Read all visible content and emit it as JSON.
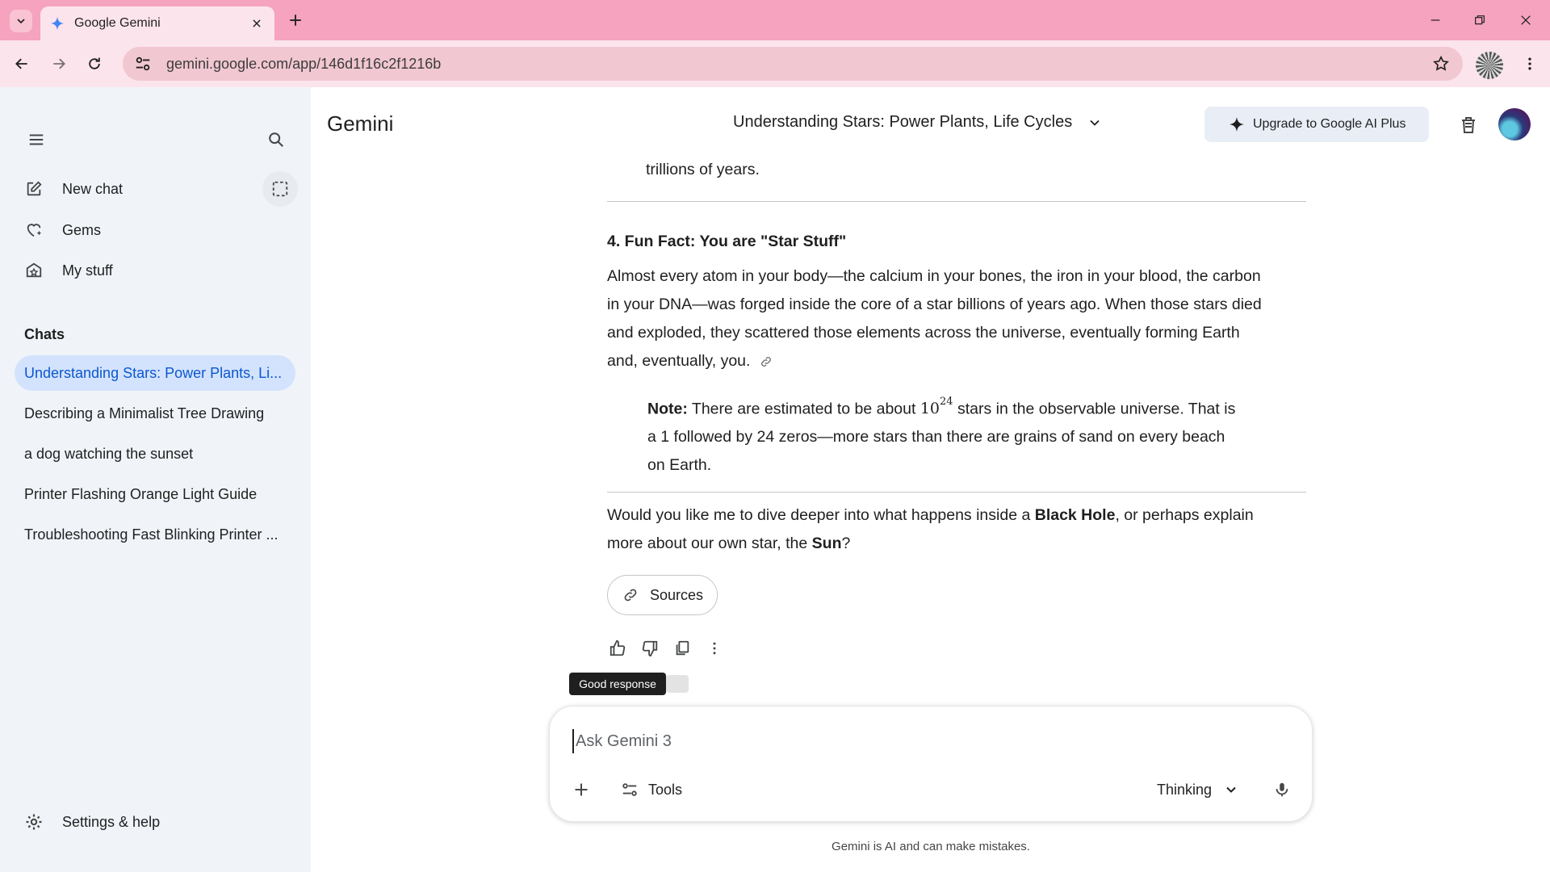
{
  "browser": {
    "tab_title": "Google Gemini",
    "url": "gemini.google.com/app/146d1f16c2f1216b"
  },
  "sidebar": {
    "items": [
      {
        "label": "New chat"
      },
      {
        "label": "Gems"
      },
      {
        "label": "My stuff"
      }
    ],
    "chats_heading": "Chats",
    "chats": [
      "Understanding Stars: Power Plants, Li...",
      "Describing a Minimalist Tree Drawing",
      "a dog watching the sunset",
      "Printer Flashing Orange Light Guide",
      "Troubleshooting Fast Blinking Printer ..."
    ],
    "settings_label": "Settings & help"
  },
  "header": {
    "brand": "Gemini",
    "conversation_title": "Understanding Stars: Power Plants, Life Cycles",
    "upgrade_label": "Upgrade to Google AI Plus"
  },
  "response": {
    "prev_tail": "trillions of years.",
    "fun_fact_heading": "4. Fun Fact: You are \"Star Stuff\"",
    "fun_fact_lines": [
      "Almost every atom in your body—the calcium in your bones, the iron in your blood, the carbon",
      "in your DNA—was forged inside the core of a star billions of years ago. When those stars died",
      "and exploded, they scattered those elements across the universe, eventually forming Earth",
      "and, eventually, you."
    ],
    "note_label": "Note:",
    "note_pre": "There are estimated to be about",
    "note_base": "10",
    "note_exp": "24",
    "note_post": "stars in the observable universe. That is",
    "note_line2": "a 1 followed by 24 zeros—more stars than there are grains of sand on every beach",
    "note_line3": "on Earth.",
    "followup_1": "Would you like me to dive deeper into what happens inside a",
    "followup_bold1": "Black Hole",
    "followup_2": ", or perhaps explain",
    "followup_3": "more about our own star, the",
    "followup_bold2": "Sun",
    "followup_4": "?",
    "sources_label": "Sources",
    "tooltip": "Good response"
  },
  "composer": {
    "placeholder": "Ask Gemini 3",
    "tools_label": "Tools",
    "mode_label": "Thinking"
  },
  "disclaimer": "Gemini is AI and can make mistakes.",
  "colors": {
    "tabbar": "#f5a3be",
    "toolbar": "#fce4ec",
    "sidebar_bg": "#f0f4f9",
    "active_chat_bg": "#d3e3fd",
    "active_chat_text": "#0b57d0"
  }
}
